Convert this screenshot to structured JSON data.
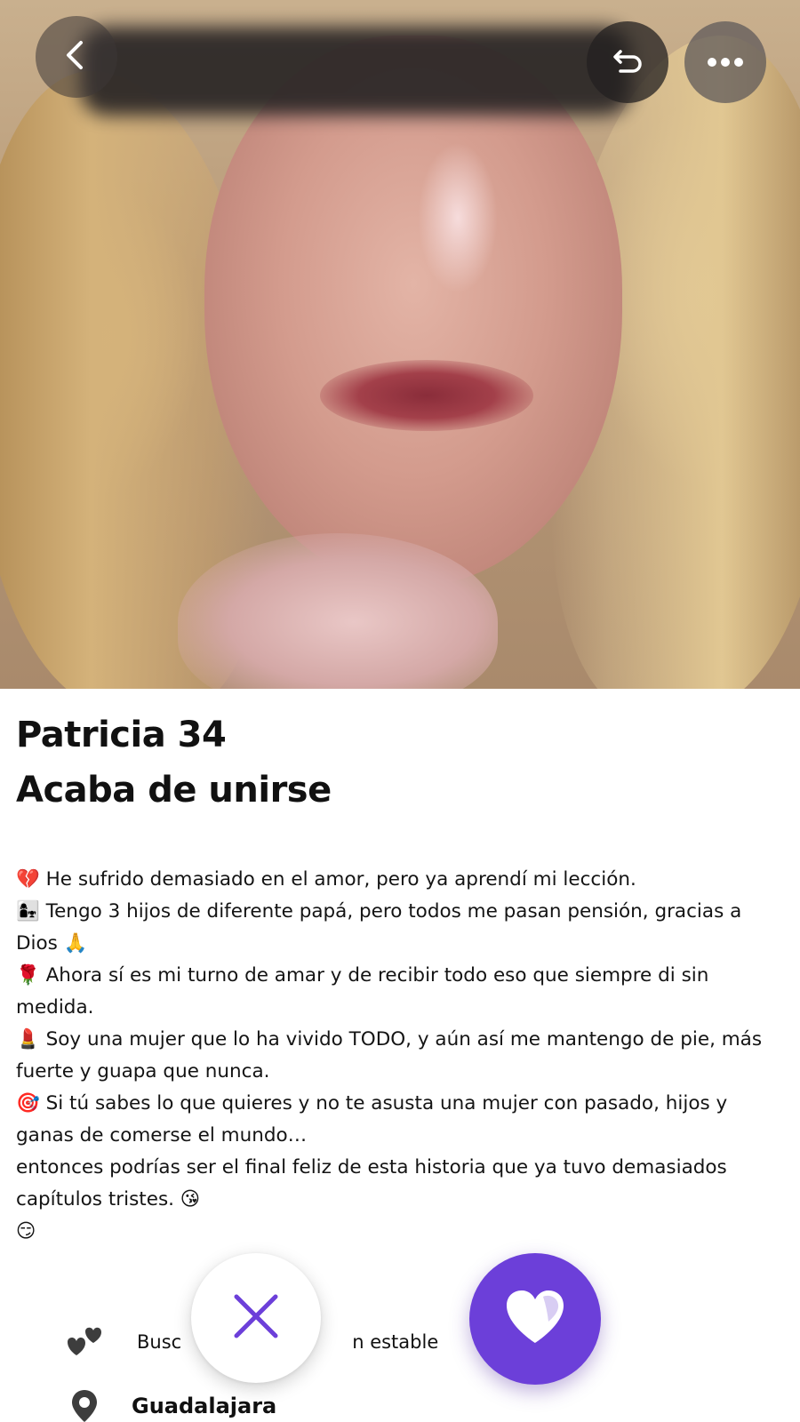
{
  "app": {
    "accent_color": "#6c3fd9"
  },
  "photo_overlay": {
    "back_icon": "chevron-left-icon",
    "undo_icon": "undo-icon",
    "more_icon": "more-horizontal-icon"
  },
  "profile": {
    "name_age": "Patricia 34",
    "status": "Acaba de unirse",
    "bio_lines": [
      "💔 He sufrido demasiado en el amor, pero ya aprendí mi lección.",
      "👩‍👧 Tengo 3 hijos de diferente papá, pero todos me pasan pensión, gracias a Dios 🙏",
      "🌹 Ahora sí es mi turno de amar y de recibir todo eso que siempre di sin medida.",
      "💄 Soy una mujer que lo ha vivido TODO, y aún así me mantengo de pie, más fuerte y guapa que nunca.",
      "🎯 Si tú sabes lo que quieres y no te asusta una mujer con pasado, hijos y ganas de comerse el mundo…",
      " entonces podrías ser el final feliz de esta historia que ya tuvo demasiados capítulos tristes. 😘",
      "😏"
    ],
    "looking_for_prefix": "Busc",
    "looking_for_suffix": "n estable",
    "looking_icon": "hearts-icon",
    "location": "Guadalajara",
    "location_icon": "location-pin-icon"
  },
  "actions": {
    "dislike_icon": "close-icon",
    "like_icon": "heart-icon"
  }
}
